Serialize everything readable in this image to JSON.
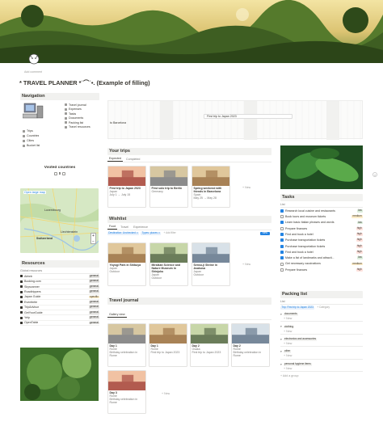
{
  "banner_alt": "landscape cover",
  "header": {
    "breadcrumb": "Add comment",
    "title": "* TRAVEL PLANNER *˙⌒˙•. (Example of filling)"
  },
  "navigation": {
    "title": "Navigation",
    "links_right": [
      "Travel journal",
      "Expenses",
      "Tasks",
      "Documents",
      "Packing list",
      "Travel resources"
    ],
    "links_left": [
      "Trips",
      "Countries",
      "Cities",
      "Bucket list"
    ]
  },
  "visited_countries": {
    "title": "Visited countries",
    "count": "0",
    "map_button": "Open large map",
    "map_labels": [
      "Luxembourg",
      "Liechtenstein",
      "Switzerland"
    ]
  },
  "resources": {
    "title": "Resources",
    "view": "Global resources",
    "items": [
      {
        "name": "Airbnb",
        "tag": "general"
      },
      {
        "name": "Booking.com",
        "tag": "general"
      },
      {
        "name": "Skyscanner",
        "tag": "general"
      },
      {
        "name": "Roadtrippers",
        "tag": "general"
      },
      {
        "name": "Japan Guide",
        "tag": "specific"
      },
      {
        "name": "Eventbrite",
        "tag": "general"
      },
      {
        "name": "TripAdvisor",
        "tag": "general"
      },
      {
        "name": "GetYourGuide",
        "tag": "general"
      },
      {
        "name": "Yelp",
        "tag": "general"
      },
      {
        "name": "OpenTable",
        "tag": "general"
      }
    ]
  },
  "timeline": {
    "tab": "Your upcoming trips",
    "bars": [
      "First trip to Japan 2023"
    ],
    "left_label": "to Barcelona"
  },
  "your_trips": {
    "title": "Your trips",
    "tabs": [
      "Expected",
      "Completed"
    ],
    "cards": [
      {
        "name": "First trip to Japan 2023",
        "country": "Japan",
        "dates": "July 1 → July 15"
      },
      {
        "name": "First solo trip to Berlin",
        "country": "Germany",
        "dates": ""
      },
      {
        "name": "Spring weekend with friends in Barcelona",
        "country": "Spain",
        "dates": "May 25 → May 28"
      }
    ],
    "new_label": "+ New"
  },
  "wishlist": {
    "title": "Wishlist",
    "tabs": [
      "Food",
      "Travel",
      "Experience"
    ],
    "filters": [
      "Destination: Unchecked ∨",
      "Types: places ∨",
      "+ Add filter"
    ],
    "new_button": "New",
    "cards": [
      {
        "name": "Yoyogi Park in Shibuya",
        "country": "Japan",
        "type": "Outdoor"
      },
      {
        "name": "Miraikan Science and Nature Museum in Shinjuku",
        "country": "Japan",
        "type": "Outdoor"
      },
      {
        "name": "Senso-ji Shrine in Asakusa",
        "country": "Japan",
        "type": "Outdoor"
      }
    ],
    "new_label": "+ New"
  },
  "journal": {
    "title": "Travel journal",
    "view": "Gallery view",
    "cards": [
      {
        "day": "Day 1",
        "place": "Rome",
        "note": "Birthday celebration in Rome"
      },
      {
        "day": "Day 1",
        "place": "Rome",
        "note": "First trip to Japan 2023"
      },
      {
        "day": "Day 2",
        "place": "Osaka",
        "note": "First trip to Japan 2023"
      },
      {
        "day": "Day 2",
        "place": "Rome",
        "note": "Birthday celebration in Rome"
      },
      {
        "day": "Day 3",
        "place": "Rome",
        "note": "Birthday celebration in Rome"
      }
    ],
    "new_label": "+ New"
  },
  "tasks": {
    "title": "Tasks",
    "view": "List",
    "items": [
      {
        "text": "Research local cuisine and restaurants",
        "tag": "low",
        "done": true
      },
      {
        "text": "Book tours and museum tickets",
        "tag": "medium",
        "done": false
      },
      {
        "text": "Learn basic Italian phrases and words",
        "tag": "low",
        "done": true
      },
      {
        "text": "Prepare finances",
        "tag": "high",
        "done": false
      },
      {
        "text": "Find and book a hotel",
        "tag": "high",
        "done": true
      },
      {
        "text": "Purchase transportation tickets",
        "tag": "high",
        "done": true
      },
      {
        "text": "Purchase transportation tickets",
        "tag": "high",
        "done": true
      },
      {
        "text": "Find and book a hotel",
        "tag": "high",
        "done": true
      },
      {
        "text": "Make a list of landmarks and attracti...",
        "tag": "low",
        "done": true
      },
      {
        "text": "Get necessary vaccinations",
        "tag": "medium",
        "done": false
      },
      {
        "text": "Prepare finances",
        "tag": "high",
        "done": false
      }
    ]
  },
  "packing": {
    "title": "Packing list",
    "view": "List",
    "filters": [
      "Trip: First trip to Japan 2023",
      "+ Category"
    ],
    "groups": [
      "documents",
      "clothing",
      "electronics and accessories",
      "other",
      "personal hygiene items"
    ],
    "new_group": "+ New",
    "add_group": "+ Add a group"
  },
  "colors": {
    "accent": "#2383e2",
    "tag_low": "#dbeddb",
    "tag_medium": "#fdecc8",
    "tag_high": "#ffe2dd",
    "tag_general": "#e3e2e0"
  }
}
